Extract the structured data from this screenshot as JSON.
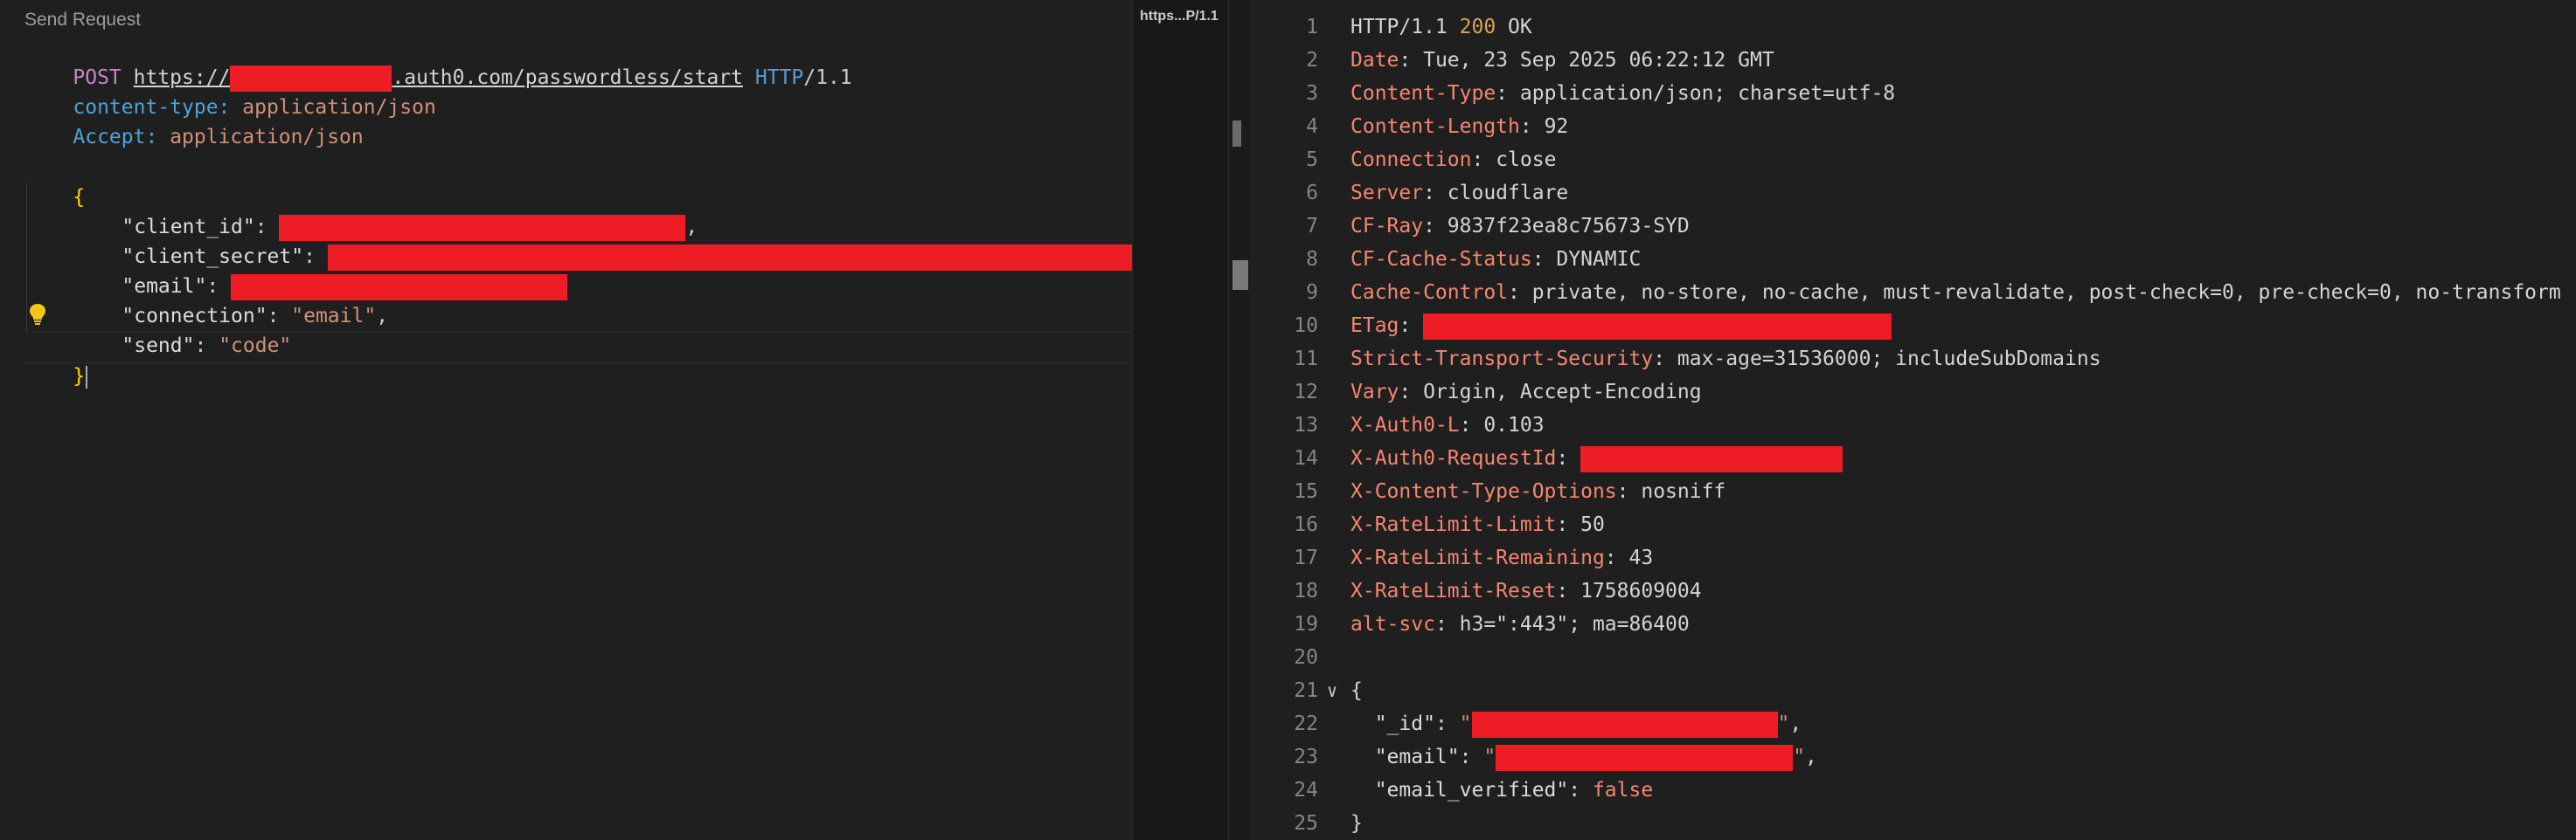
{
  "request": {
    "codelens_label": "Send Request",
    "method": "POST",
    "url_prefix": "https://",
    "url_suffix": ".auth0.com/passwordless/start",
    "protocol": "HTTP",
    "protocol_version": "/1.1",
    "headers": [
      {
        "name": "content-type:",
        "value": "application/json"
      },
      {
        "name": "Accept:",
        "value": "application/json"
      }
    ],
    "body": {
      "open_brace": "{",
      "close_brace": "}",
      "fields": [
        {
          "key": "\"client_id\"",
          "value": "",
          "redacted": true,
          "suffix": ","
        },
        {
          "key": "\"client_secret\"",
          "value": "",
          "redacted": true,
          "suffix": ","
        },
        {
          "key": "\"email\"",
          "value": "",
          "redacted": true,
          "suffix": ""
        },
        {
          "key": "\"connection\"",
          "value": "\"email\"",
          "redacted": false,
          "suffix": ","
        },
        {
          "key": "\"send\"",
          "value": "\"code\"",
          "redacted": false,
          "suffix": ""
        }
      ]
    }
  },
  "tab": {
    "label": "https...P/1.1"
  },
  "response": {
    "lines": [
      {
        "n": "1",
        "status_proto": "HTTP/1.1 ",
        "status_code": "200",
        "status_text": " OK"
      },
      {
        "n": "2",
        "name": "Date",
        "value": "Tue, 23 Sep 2025 06:22:12 GMT"
      },
      {
        "n": "3",
        "name": "Content-Type",
        "value": "application/json; charset=utf-8"
      },
      {
        "n": "4",
        "name": "Content-Length",
        "value": "92"
      },
      {
        "n": "5",
        "name": "Connection",
        "value": "close"
      },
      {
        "n": "6",
        "name": "Server",
        "value": "cloudflare"
      },
      {
        "n": "7",
        "name": "CF-Ray",
        "value": "9837f23ea8c75673-SYD"
      },
      {
        "n": "8",
        "name": "CF-Cache-Status",
        "value": "DYNAMIC"
      },
      {
        "n": "9",
        "name": "Cache-Control",
        "value": "private, no-store, no-cache, must-revalidate, post-check=0, pre-check=0, no-transform"
      },
      {
        "n": "10",
        "name": "ETag",
        "value": "",
        "redacted": true
      },
      {
        "n": "11",
        "name": "Strict-Transport-Security",
        "value": "max-age=31536000; includeSubDomains"
      },
      {
        "n": "12",
        "name": "Vary",
        "value": "Origin, Accept-Encoding"
      },
      {
        "n": "13",
        "name": "X-Auth0-L",
        "value": "0.103"
      },
      {
        "n": "14",
        "name": "X-Auth0-RequestId",
        "value": "",
        "redacted": true
      },
      {
        "n": "15",
        "name": "X-Content-Type-Options",
        "value": "nosniff"
      },
      {
        "n": "16",
        "name": "X-RateLimit-Limit",
        "value": "50"
      },
      {
        "n": "17",
        "name": "X-RateLimit-Remaining",
        "value": "43"
      },
      {
        "n": "18",
        "name": "X-RateLimit-Reset",
        "value": "1758609004"
      },
      {
        "n": "19",
        "name": "alt-svc",
        "value": "h3=\":443\"; ma=86400"
      },
      {
        "n": "20",
        "blank": true
      },
      {
        "n": "21",
        "open": "{",
        "foldable": true
      },
      {
        "n": "22",
        "json_key": "\"_id\"",
        "redacted": true
      },
      {
        "n": "23",
        "json_key": "\"email\"",
        "redacted": true
      },
      {
        "n": "24",
        "json_key": "\"email_verified\"",
        "json_value": "false"
      },
      {
        "n": "25",
        "close": "}"
      }
    ]
  },
  "icons": {
    "lightbulb": "lightbulb-icon",
    "fold": "chevron-down-icon"
  }
}
